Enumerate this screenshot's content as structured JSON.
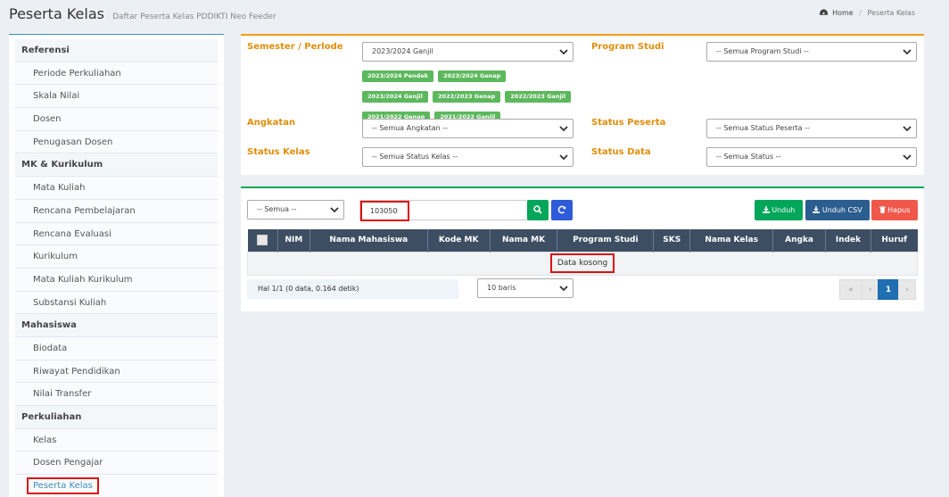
{
  "header": {
    "title": "Peserta Kelas",
    "subtitle": "Daftar Peserta Kelas PDDIKTI Neo Feeder",
    "breadcrumb_home": "Home",
    "breadcrumb_sep": "/",
    "breadcrumb_current": "Peserta Kelas"
  },
  "sidebar": {
    "sections": [
      {
        "title": "Referensi",
        "items": [
          "Periode Perkuliahan",
          "Skala Nilai",
          "Dosen",
          "Penugasan Dosen"
        ]
      },
      {
        "title": "MK & Kurikulum",
        "items": [
          "Mata Kuliah",
          "Rencana Pembelajaran",
          "Rencana Evaluasi",
          "Kurikulum",
          "Mata Kuliah Kurikulum",
          "Substansi Kuliah"
        ]
      },
      {
        "title": "Mahasiswa",
        "items": [
          "Biodata",
          "Riwayat Pendidikan",
          "Nilai Transfer"
        ]
      },
      {
        "title": "Perkuliahan",
        "items": [
          "Kelas",
          "Dosen Pengajar",
          "Peserta Kelas"
        ]
      }
    ],
    "active_item": "Peserta Kelas"
  },
  "filters": {
    "semester_label": "Semester / Perlode",
    "semester_value": "2023/2024 Ganjil",
    "semester_chips": [
      "2023/2024 Pendek",
      "2023/2024 Genap",
      "2023/2024 Ganjil",
      "2022/2023 Genap",
      "2022/2023 Ganjil",
      "2021/2022 Genap",
      "2021/2022 Ganjil"
    ],
    "prodi_label": "Program Studi",
    "prodi_value": "-- Semua Program Studi --",
    "angkatan_label": "Angkatan",
    "angkatan_value": "-- Semua Angkatan --",
    "status_peserta_label": "Status Peserta",
    "status_peserta_value": "-- Semua Status Peserta --",
    "status_kelas_label": "Status Kelas",
    "status_kelas_value": "-- Semua Status Kelas --",
    "status_data_label": "Status Data",
    "status_data_value": "-- Semua Status --"
  },
  "toolbar": {
    "filter_value": "-- Semua --",
    "search_value": "103050",
    "unduh_label": "Unduh",
    "csv_label": "Unduh CSV",
    "hapus_label": "Hapus"
  },
  "table": {
    "columns": [
      "NIM",
      "Nama Mahasiswa",
      "Kode MK",
      "Nama MK",
      "Program Studi",
      "SKS",
      "Nama Kelas",
      "Angka",
      "Indek",
      "Huruf"
    ],
    "empty_text": "Data kosong"
  },
  "footer": {
    "info": "Hal 1/1 (0 data, 0.164 detik)",
    "rows_value": "10 baris",
    "pager_first": "«",
    "pager_prev": "‹",
    "pager_current": "1",
    "pager_next": "›"
  },
  "colors": {
    "primary": "#3c8dbc",
    "warning": "#f39c12",
    "success": "#00a65a",
    "danger": "#f0584c",
    "table_header": "#3d4e63"
  }
}
